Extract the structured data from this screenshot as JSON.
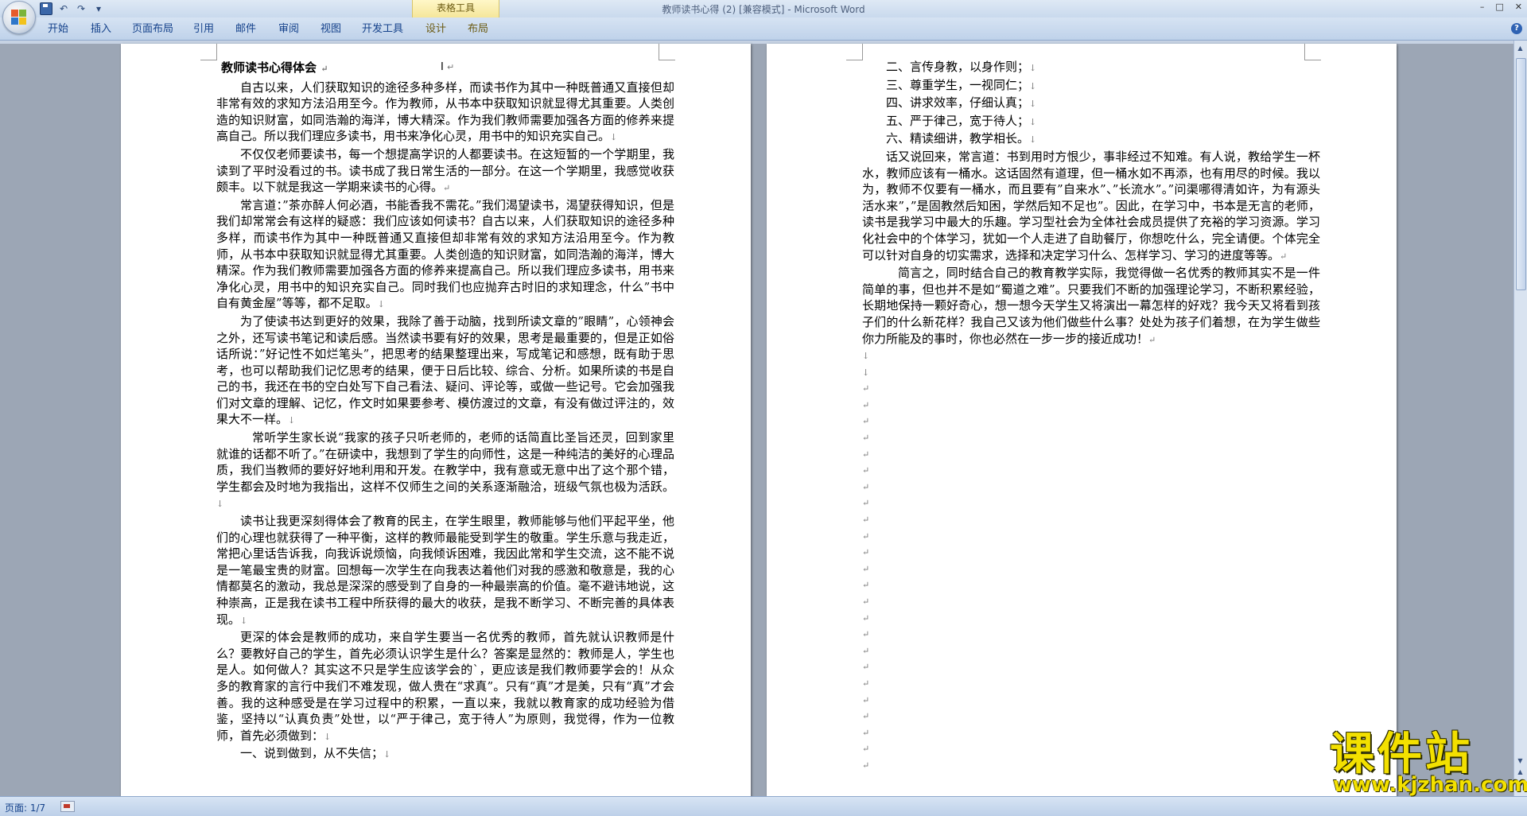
{
  "window": {
    "title": "教师读书心得 (2) [兼容模式] - Microsoft Word",
    "context_tab_group": "表格工具",
    "controls": [
      "–",
      "□",
      "✕"
    ]
  },
  "quick_access": {
    "icons": [
      "save-icon",
      "undo-icon",
      "redo-icon",
      "customize-icon"
    ],
    "undo": "↶",
    "redo": "↷",
    "more": "▾"
  },
  "ribbon_tabs": [
    "开始",
    "插入",
    "页面布局",
    "引用",
    "邮件",
    "审阅",
    "视图",
    "开发工具",
    "设计",
    "布局"
  ],
  "help": "?",
  "page1": {
    "title": "教师读书心得体会",
    "cursor": "I",
    "paragraphs": [
      "自古以来，人们获取知识的途径多种多样，而读书作为其中一种既普通又直接但却非常有效的求知方法沿用至今。作为教师，从书本中获取知识就显得尤其重要。人类创造的知识财富，如同浩瀚的海洋，博大精深。作为我们教师需要加强各方面的修养来提高自己。所以我们理应多读书，用书来净化心灵，用书中的知识充实自己。",
      "不仅仅老师要读书，每一个想提高学识的人都要读书。在这短暂的一个学期里，我读到了平时没看过的书。读书成了我日常生活的一部分。在这一个学期里，我感觉收获颇丰。以下就是我这一学期来读书的心得。",
      "常言道：”茶亦醉人何必酒，书能香我不需花。”我们渴望读书，渴望获得知识，但是我们却常常会有这样的疑惑：我们应该如何读书？自古以来，人们获取知识的途径多种多样，而读书作为其中一种既普通又直接但却非常有效的求知方法沿用至今。作为教师，从书本中获取知识就显得尤其重要。人类创造的知识财富，如同浩瀚的海洋，博大精深。作为我们教师需要加强各方面的修养来提高自己。所以我们理应多读书，用书来净化心灵，用书中的知识充实自己。同时我们也应抛弃古时旧的求知理念，什么”书中自有黄金屋”等等，都不足取。",
      "为了使读书达到更好的效果，我除了善于动脑，找到所读文章的”眼睛”，心领神会之外，还写读书笔记和读后感。当然读书要有好的效果，思考是最重要的，但是正如俗话所说：”好记性不如烂笔头”，把思考的结果整理出来，写成笔记和感想，既有助于思考，也可以帮助我们记忆思考的结果，便于日后比较、综合、分析。如果所读的书是自己的书，我还在书的空白处写下自己看法、疑问、评论等，或做一些记号。它会加强我们对文章的理解、记忆，作文时如果要参考、模仿渡过的文章，有没有做过评注的，效果大不一样。",
      "常听学生家长说“我家的孩子只听老师的，老师的话简直比圣旨还灵，回到家里就谁的话都不听了。”在研读中，我想到了学生的向师性，这是一种纯洁的美好的心理品质，我们当教师的要好好地利用和开发。在教学中，我有意或无意中出了这个那个错，学生都会及时地为我指出，这样不仅师生之间的关系逐渐融洽，班级气氛也极为活跃。",
      "读书让我更深刻得体会了教育的民主，在学生眼里，教师能够与他们平起平坐，他们的心理也就获得了一种平衡，这样的教师最能受到学生的敬重。学生乐意与我走近，常把心里话告诉我，向我诉说烦恼，向我倾诉困难，我因此常和学生交流，这不能不说是一笔最宝贵的财富。回想每一次学生在向我表达着他们对我的感激和敬意是，我的心情都莫名的激动，我总是深深的感受到了自身的一种最崇高的价值。毫不避讳地说，这种崇高，正是我在读书工程中所获得的最大的收获，是我不断学习、不断完善的具体表现。",
      "更深的体会是教师的成功，来自学生要当一名优秀的教师，首先就认识教师是什么？要教好自己的学生，首先必须认识学生是什么？答案是显然的：教师是人，学生也是人。如何做人？其实这不只是学生应该学会的`，更应该是我们教师要学会的！从众多的教育家的言行中我们不难发现，做人贵在“求真”。只有“真”才是美，只有“真”才会善。我的这种感受是在学习过程中的积累，一直以来，我就以教育家的成功经验为借鉴，坚持以“认真负责”处世，以“严于律己，宽于待人”为原则，我觉得，作为一位教师，首先必须做到："
    ],
    "last_line": "一、说到做到，从不失信；"
  },
  "page2": {
    "list": [
      "二、言传身教，以身作则；",
      "三、尊重学生，一视同仁；",
      "四、讲求效率，仔细认真；",
      "五、严于律己，宽于待人；",
      "六、精读细讲，教学相长。"
    ],
    "paragraphs": [
      "话又说回来，常言道：书到用时方恨少，事非经过不知难。有人说，教给学生一杯水，教师应该有一桶水。这话固然有道理，但一桶水如不再添，也有用尽的时候。我以为，教师不仅要有一桶水，而且要有”自来水”、”长流水”。”问渠哪得清如许，为有源头活水来”，”是固教然后知困，学然后知不足也”。因此，在学习中，书本是无言的老师，读书是我学习中最大的乐趣。学习型社会为全体社会成员提供了充裕的学习资源。学习化社会中的个体学习，犹如一个人走进了自助餐厅，你想吃什么，完全请便。个体完全可以针对自身的切实需求，选择和决定学习什么、怎样学习、学习的进度等等。",
      "简言之，同时结合自己的教育教学实际，我觉得做一名优秀的教师其实不是一件简单的事，但也并不是如“蜀道之难”。只要我们不断的加强理论学习，不断积累经验，长期地保持一颗好奇心，想一想今天学生又将演出一幕怎样的好戏？我今天又将看到孩子们的什么新花样？我自己又该为他们做些什么事？处处为孩子们着想，在为学生做些你力所能及的事时，你也必然在一步一步的接近成功！"
    ]
  },
  "marks": {
    "para_end": "↵",
    "line_break": "↓"
  },
  "status": {
    "page": "页面: 1/7"
  },
  "watermark": {
    "brand": "课件站",
    "url": "www.kjzhan.com"
  }
}
